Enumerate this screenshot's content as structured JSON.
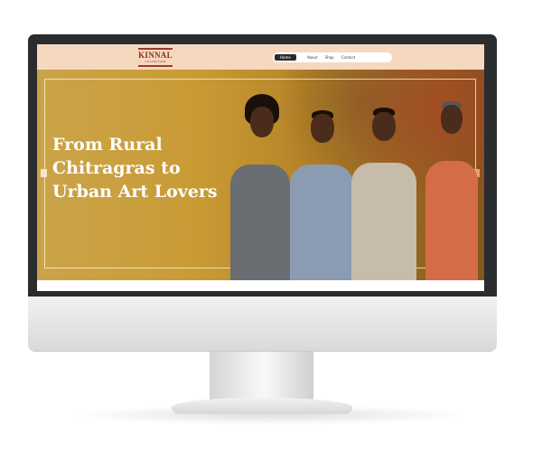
{
  "site": {
    "logo": {
      "name": "KINNAL",
      "subtitle": "COLLECTION"
    },
    "nav": {
      "items": [
        {
          "label": "Home",
          "active": true
        },
        {
          "label": "About",
          "active": false
        },
        {
          "label": "Shop",
          "active": false
        },
        {
          "label": "Contact",
          "active": false
        }
      ]
    },
    "hero": {
      "title_line1": "From Rural",
      "title_line2": "Chitragras to",
      "title_line3": "Urban Art Lovers"
    }
  },
  "colors": {
    "header_bg": "#f6d8bf",
    "hero_gold": "#c99b35",
    "bezel": "#2b2c2e"
  }
}
